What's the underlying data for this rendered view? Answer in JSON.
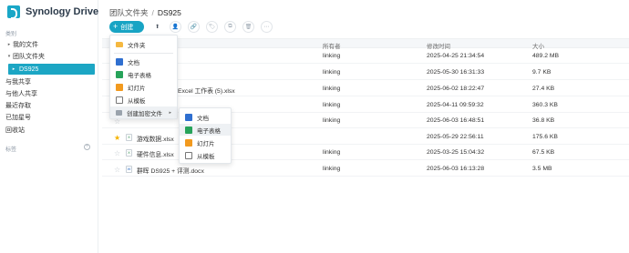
{
  "app": {
    "title": "Synology Drive"
  },
  "sidebar": {
    "section_label": "类别",
    "items": [
      {
        "label": "我的文件",
        "caret": "▸"
      },
      {
        "label": "团队文件夹",
        "caret": "▾"
      },
      {
        "label": "DS925",
        "caret": "▸"
      },
      {
        "label": "与我共享",
        "caret": ""
      },
      {
        "label": "与他人共享",
        "caret": ""
      },
      {
        "label": "最近存取",
        "caret": ""
      },
      {
        "label": "已加星号",
        "caret": ""
      },
      {
        "label": "回收站",
        "caret": ""
      }
    ],
    "tags_label": "标签",
    "tags_add": "+"
  },
  "breadcrumb": {
    "root": "团队文件夹",
    "sep": "/",
    "current": "DS925"
  },
  "toolbar": {
    "create_label": "创建",
    "create_icon": "+",
    "upload_icon": "⬆",
    "share_icon": "👤",
    "link_icon": "🔗",
    "tag_icon": "🏷",
    "copy_icon": "⧉",
    "delete_icon": "🗑",
    "more_icon": "⋯"
  },
  "table": {
    "headers": {
      "owner": "所有者",
      "modified": "修改时间",
      "size": "大小"
    },
    "rows": [
      {
        "name": "",
        "owner": "linking",
        "modified": "2025-04-25 21:34:54",
        "size": "489.2 MB",
        "starred": false,
        "type": "sheet"
      },
      {
        "name": "",
        "owner": "linking",
        "modified": "2025-05-30 16:31:33",
        "size": "9.7 KB",
        "starred": false,
        "type": "sheet"
      },
      {
        "name": "Excel 工作表 (5).xlsx",
        "owner": "linking",
        "modified": "2025-06-02 18:22:47",
        "size": "27.4 KB",
        "starred": false,
        "type": "sheet"
      },
      {
        "name": "",
        "owner": "linking",
        "modified": "2025-04-11 09:59:32",
        "size": "360.3 KB",
        "starred": false,
        "type": "sheet"
      },
      {
        "name": "",
        "owner": "linking",
        "modified": "2025-06-03 16:48:51",
        "size": "36.8 KB",
        "starred": false,
        "type": "sheet"
      },
      {
        "name": "游戏数据.xlsx",
        "owner": "",
        "modified": "2025-05-29 22:56:11",
        "size": "175.6 KB",
        "starred": true,
        "type": "sheet"
      },
      {
        "name": "硬件信息.xlsx",
        "owner": "linking",
        "modified": "2025-03-25 15:04:32",
        "size": "67.5 KB",
        "starred": false,
        "type": "sheet"
      },
      {
        "name": "群晖 DS925 + 评测.docx",
        "owner": "linking",
        "modified": "2025-06-03 16:13:28",
        "size": "3.5 MB",
        "starred": false,
        "type": "doc"
      }
    ]
  },
  "create_menu": {
    "items": [
      {
        "label": "文件夹",
        "icon": "folder-icon"
      },
      {
        "label": "文档",
        "icon": "doc-icon"
      },
      {
        "label": "电子表格",
        "icon": "sheet-icon"
      },
      {
        "label": "幻灯片",
        "icon": "slide-icon"
      },
      {
        "label": "从模板",
        "icon": "template-icon"
      },
      {
        "label": "创建加密文件",
        "icon": "lock-icon",
        "arrow": "▸"
      }
    ]
  },
  "encrypted_submenu": {
    "items": [
      {
        "label": "文档",
        "icon": "doc-icon"
      },
      {
        "label": "电子表格",
        "icon": "sheet-icon"
      },
      {
        "label": "幻灯片",
        "icon": "slide-icon"
      },
      {
        "label": "从模板",
        "icon": "template-icon"
      }
    ]
  },
  "colors": {
    "accent": "#18a4c4",
    "star": "#f5b301",
    "doc": "#2f6fd0",
    "sheet": "#27a35a",
    "slide": "#f29a1f",
    "folder": "#f5b840"
  }
}
